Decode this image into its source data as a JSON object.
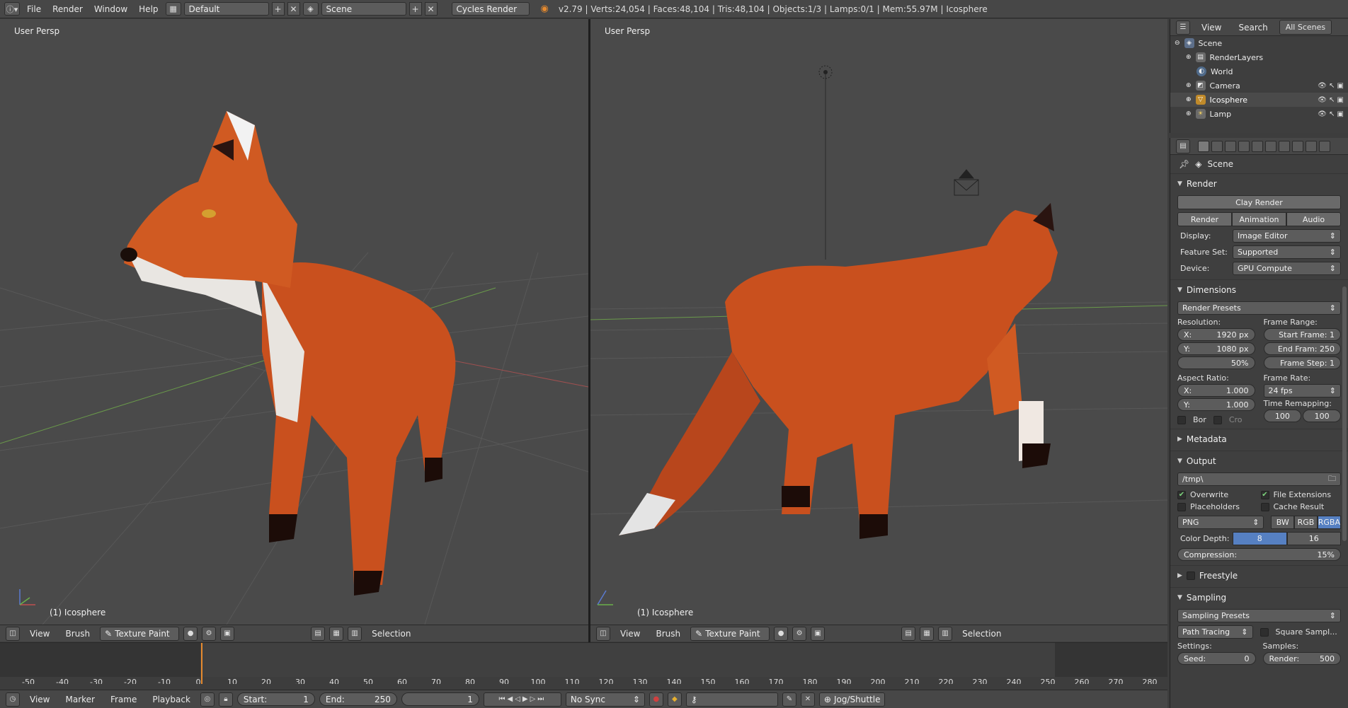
{
  "topbar": {
    "menu": [
      "File",
      "Render",
      "Window",
      "Help"
    ],
    "layout": "Default",
    "scene": "Scene",
    "engine": "Cycles Render",
    "stats": "v2.79 | Verts:24,054 | Faces:48,104 | Tris:48,104 | Objects:1/3 | Lamps:0/1 | Mem:55.97M | Icosphere"
  },
  "viewports": {
    "left": {
      "label": "User Persp",
      "object": "(1) Icosphere"
    },
    "right": {
      "label": "User Persp",
      "object": "(1) Icosphere"
    }
  },
  "view_header": {
    "menus": [
      "View",
      "Brush"
    ],
    "mode": "Texture Paint",
    "selection": "Selection"
  },
  "timeline": {
    "ticks": [
      "-50",
      "-40",
      "-30",
      "-20",
      "-10",
      "0",
      "10",
      "20",
      "30",
      "40",
      "50",
      "60",
      "70",
      "80",
      "90",
      "100",
      "110",
      "120",
      "130",
      "140",
      "150",
      "160",
      "170",
      "180",
      "190",
      "200",
      "210",
      "220",
      "230",
      "240",
      "250",
      "260",
      "270",
      "280"
    ]
  },
  "bottombar": {
    "menus": [
      "View",
      "Marker",
      "Frame",
      "Playback"
    ],
    "start_label": "Start:",
    "start": "1",
    "end_label": "End:",
    "end": "250",
    "current": "1",
    "sync": "No Sync",
    "jog": "Jog/Shuttle"
  },
  "outliner": {
    "menus": [
      "View",
      "Search"
    ],
    "active_tab": "All Scenes",
    "items": [
      {
        "label": "Scene"
      },
      {
        "label": "RenderLayers"
      },
      {
        "label": "World"
      },
      {
        "label": "Camera"
      },
      {
        "label": "Icosphere"
      },
      {
        "label": "Lamp"
      }
    ]
  },
  "properties": {
    "context": "Scene",
    "render": {
      "title": "Render",
      "clay_render": "Clay Render",
      "buttons": [
        "Render",
        "Animation",
        "Audio"
      ],
      "display_label": "Display:",
      "display": "Image Editor",
      "feature_set_label": "Feature Set:",
      "feature_set": "Supported",
      "device_label": "Device:",
      "device": "GPU Compute"
    },
    "dimensions": {
      "title": "Dimensions",
      "presets": "Render Presets",
      "resolution_label": "Resolution:",
      "res_x": "1920 px",
      "res_y": "1080 px",
      "res_pct": "50%",
      "frame_range_label": "Frame Range:",
      "start_frame": "Start Frame: 1",
      "end_frame": "End Fram: 250",
      "frame_step": "Frame Step: 1",
      "aspect_label": "Aspect Ratio:",
      "aspect_x": "1.000",
      "aspect_y": "1.000",
      "frame_rate_label": "Frame Rate:",
      "frame_rate": "24 fps",
      "time_remap_label": "Time Remapping:",
      "remap_old": "100",
      "remap_new": "100",
      "bor": "Bor",
      "cro": "Cro"
    },
    "metadata": {
      "title": "Metadata"
    },
    "output": {
      "title": "Output",
      "path": "/tmp\\",
      "overwrite": "Overwrite",
      "file_ext": "File Extensions",
      "placeholders": "Placeholders",
      "cache_result": "Cache Result",
      "format": "PNG",
      "color_modes": [
        "BW",
        "RGB",
        "RGBA"
      ],
      "color_depth_label": "Color Depth:",
      "depths": [
        "8",
        "16"
      ],
      "compression": "Compression:",
      "compression_val": "15%"
    },
    "freestyle": {
      "title": "Freestyle"
    },
    "sampling": {
      "title": "Sampling",
      "presets": "Sampling Presets",
      "method": "Path Tracing",
      "square_samples": "Square Sampl...",
      "settings_label": "Settings:",
      "samples_label": "Samples:",
      "seed": "Seed:",
      "seed_val": "0",
      "render": "Render:",
      "render_val": "500"
    }
  },
  "colors": {
    "accent": "#e68a2e",
    "select_blue": "#5680c2",
    "fox": "#c9501e"
  }
}
